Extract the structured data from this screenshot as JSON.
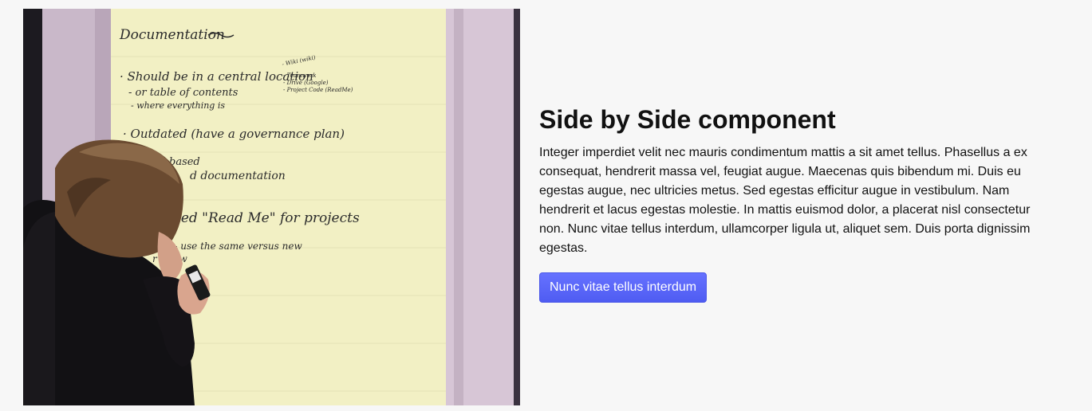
{
  "image": {
    "alt": "",
    "handwriting": {
      "heading": "Documentation",
      "line1": "· Should be in a central location",
      "line2": "- or table of contents",
      "line3": "- where everything is",
      "side1": "- Wiki (wiki)",
      "side2": "- Teamwork",
      "side3": "- Drive (Google)",
      "side4": "- Project Code (ReadMe)",
      "line4": "· Outdated (have a governance plan)",
      "line5": "based",
      "line6": "d documentation",
      "line7": "ted \"Read Me\" for projects",
      "line8": "ng- use the same versus new",
      "line9": "r Know"
    }
  },
  "content": {
    "title": "Side by Side component",
    "body": "Integer imperdiet velit nec mauris condimentum mattis a sit amet tellus. Phasellus a ex consequat, hendrerit massa vel, feugiat augue. Maecenas quis bibendum mi. Duis eu egestas augue, nec ultricies metus. Sed egestas efficitur augue in vestibulum. Nam hendrerit et lacus egestas molestie. In mattis euismod dolor, a placerat nisl consectetur non. Nunc vitae tellus interdum, ullamcorper ligula ut, aliquet sem. Duis porta dignissim egestas.",
    "button_label": "Nunc vitae tellus interdum"
  },
  "colors": {
    "page_background": "#f7f7f7",
    "button_background": "#5763f5",
    "button_text": "#ffffff",
    "paper": "#f2f0c4"
  }
}
